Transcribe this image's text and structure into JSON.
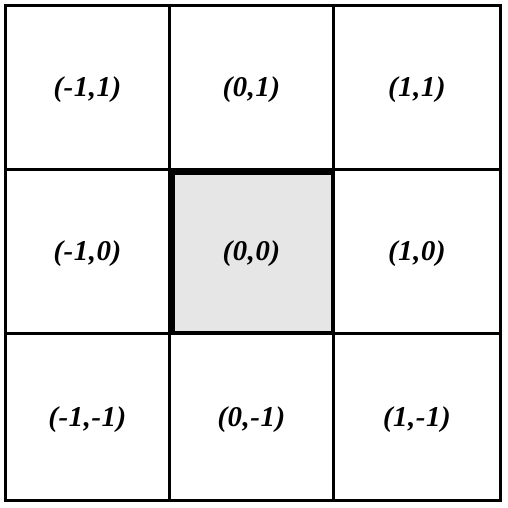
{
  "grid": {
    "center_fill": "#e6e6e6",
    "line_color": "#000000",
    "cells": [
      {
        "label": "(-1,1)"
      },
      {
        "label": "(0,1)"
      },
      {
        "label": "(1,1)"
      },
      {
        "label": "(-1,0)"
      },
      {
        "label": "(0,0)"
      },
      {
        "label": "(1,0)"
      },
      {
        "label": "(-1,-1)"
      },
      {
        "label": "(0,-1)"
      },
      {
        "label": "(1,-1)"
      }
    ]
  }
}
